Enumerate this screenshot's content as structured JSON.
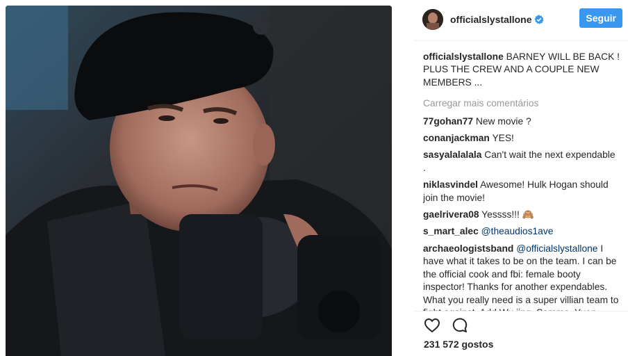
{
  "post": {
    "author": "officialslystallone",
    "follow_label": "Seguir",
    "caption": "BARNEY WILL BE BACK ! PLUS THE CREW AND A COUPLE NEW MEMBERS ...",
    "load_more_label": "Carregar mais comentários",
    "likes_text": "231 572 gostos"
  },
  "comments": [
    {
      "user": "77gohan77",
      "text": "New movie ?"
    },
    {
      "user": "conanjackman",
      "text": "YES!"
    },
    {
      "user": "sasyalalalala",
      "text": "Can't wait the next expendable ."
    },
    {
      "user": "niklasvindel",
      "text": "Awesome! Hulk Hogan should join the movie!"
    },
    {
      "user": "gaelrivera08",
      "text": "Yessss!!! 🙈"
    },
    {
      "user": "s_mart_alec",
      "mention": "@theaudios1ave",
      "text": ""
    },
    {
      "user": "archaeologistsband",
      "mention": "@officialslystallone",
      "text": "I have what it takes to be on the team. I can be the official cook and fbi: female booty inspector! Thanks for another expendables. What you really need is a super villian team to fight against. Add Wu jing, Sammo, Yuen"
    }
  ],
  "icons": {
    "verified": "verified-badge-icon",
    "like": "heart-icon",
    "comment": "speech-bubble-icon"
  },
  "colors": {
    "accent": "#3897f0",
    "mention": "#003569",
    "muted": "#999999"
  }
}
